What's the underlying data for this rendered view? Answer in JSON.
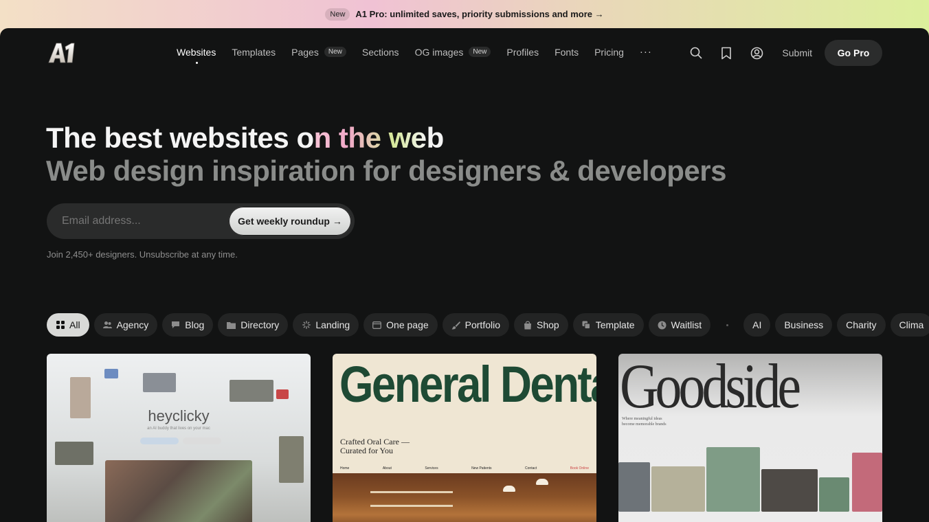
{
  "announcement": {
    "badge": "New",
    "text": "A1 Pro: unlimited saves, priority submissions and more →"
  },
  "header": {
    "logo_text": "A1",
    "nav": [
      {
        "label": "Websites",
        "badge": ""
      },
      {
        "label": "Templates",
        "badge": ""
      },
      {
        "label": "Pages",
        "badge": "New"
      },
      {
        "label": "Sections",
        "badge": ""
      },
      {
        "label": "OG images",
        "badge": "New"
      },
      {
        "label": "Profiles",
        "badge": ""
      },
      {
        "label": "Fonts",
        "badge": ""
      },
      {
        "label": "Pricing",
        "badge": ""
      }
    ],
    "more_label": "···",
    "submit_label": "Submit",
    "gopro_label": "Go Pro",
    "icons": [
      "search-icon",
      "bookmark-icon",
      "account-icon"
    ]
  },
  "hero": {
    "title_plain": "The best websites o",
    "title_grad": "n the we",
    "title_end": "b",
    "subtitle": "Web design inspiration for designers & developers",
    "email_placeholder": "Email address...",
    "cta_label": "Get weekly roundup →",
    "join_text": "Join 2,450+ designers. Unsubscribe at any time."
  },
  "filters": {
    "primary": [
      {
        "label": "All",
        "icon": "grid-icon",
        "active": true
      },
      {
        "label": "Agency",
        "icon": "people-icon"
      },
      {
        "label": "Blog",
        "icon": "chat-icon"
      },
      {
        "label": "Directory",
        "icon": "folder-icon"
      },
      {
        "label": "Landing",
        "icon": "spark-icon"
      },
      {
        "label": "One page",
        "icon": "window-icon"
      },
      {
        "label": "Portfolio",
        "icon": "brush-icon"
      },
      {
        "label": "Shop",
        "icon": "bag-icon"
      },
      {
        "label": "Template",
        "icon": "copy-icon"
      },
      {
        "label": "Waitlist",
        "icon": "clock-icon"
      }
    ],
    "secondary": [
      "AI",
      "Business",
      "Charity",
      "Clima"
    ]
  },
  "cards": [
    {
      "title": "heyclicky",
      "subtitle": "an AI buddy that lives on your mac"
    },
    {
      "title": "General Dental",
      "tagline_1": "Crafted Oral Care —",
      "tagline_2": "Curated for You",
      "nav": [
        "Home",
        "About",
        "Services",
        "New Patients",
        "Contact",
        "Book Online"
      ]
    },
    {
      "title": "Goodside",
      "subtitle_1": "Where meaningful ideas",
      "subtitle_2": "become memorable brands"
    }
  ],
  "colors": {
    "panel_bg": "#121313",
    "chip_bg": "#232424",
    "chip_active_bg": "#d8d9d7",
    "dental_green": "#1e4a34"
  }
}
